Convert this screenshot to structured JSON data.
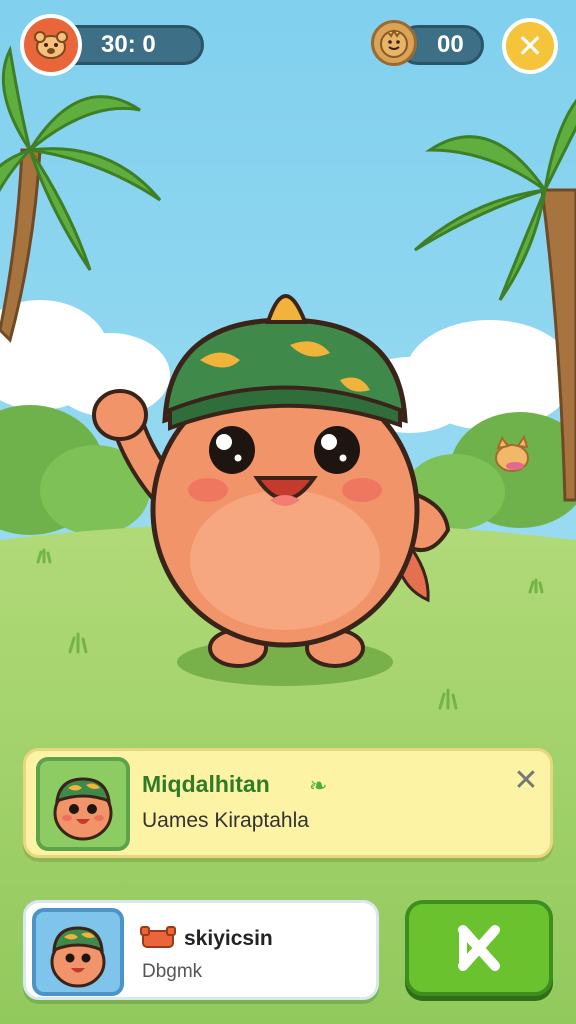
{
  "hud": {
    "timer_text": "30: 0",
    "coin_count": "00"
  },
  "info_card": {
    "title": "Miqdalhitan",
    "subtitle": "Uames Kiraptahla"
  },
  "user_card": {
    "name": "skiyicsin",
    "status": "Dbgmk"
  },
  "colors": {
    "sky": "#8fd7f1",
    "grass": "#9fd26b",
    "accent_orange": "#e8663a",
    "gold": "#f6c43a",
    "button_green": "#6ac22f"
  },
  "icons": [
    "bear-icon",
    "coin-icon",
    "close-icon",
    "leaf-icon",
    "bear-small-icon",
    "confirm-close-icon"
  ]
}
